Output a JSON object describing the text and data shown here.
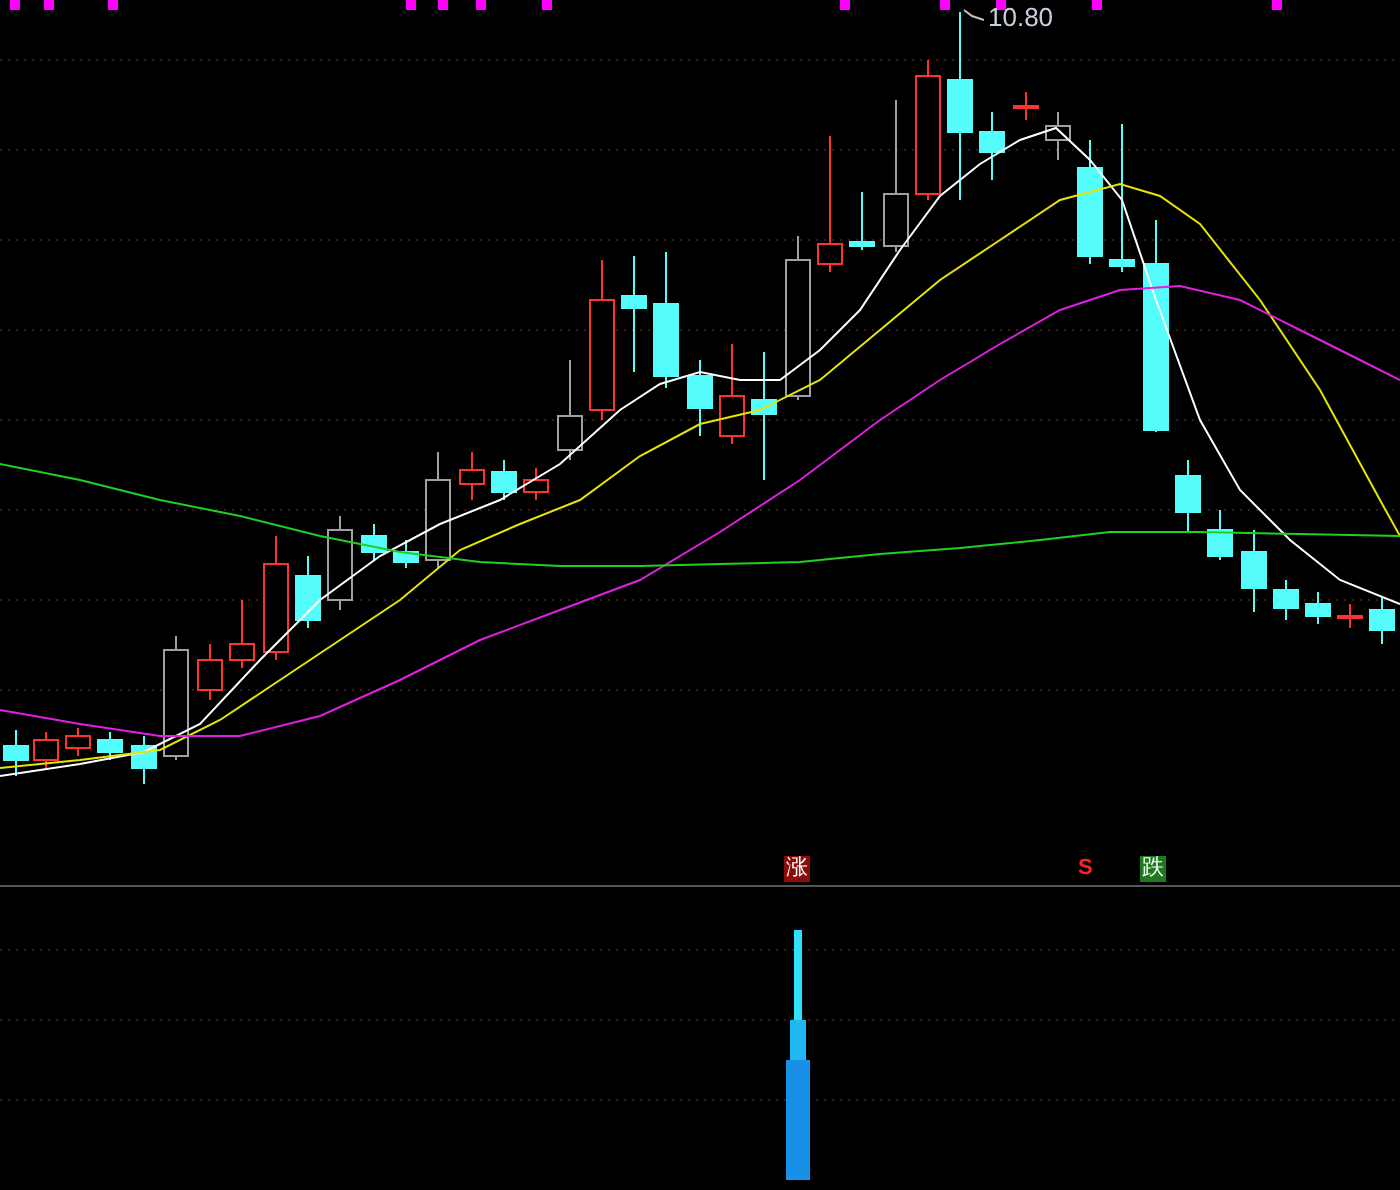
{
  "high_label": "10.80",
  "signals": [
    {
      "kind": "badge",
      "text": "涨",
      "color": "#8b0a0a"
    },
    {
      "kind": "arrow",
      "text": "S",
      "color": "#ff2020"
    },
    {
      "kind": "badge",
      "text": "跌",
      "color": "#1f7a1f"
    }
  ]
}
